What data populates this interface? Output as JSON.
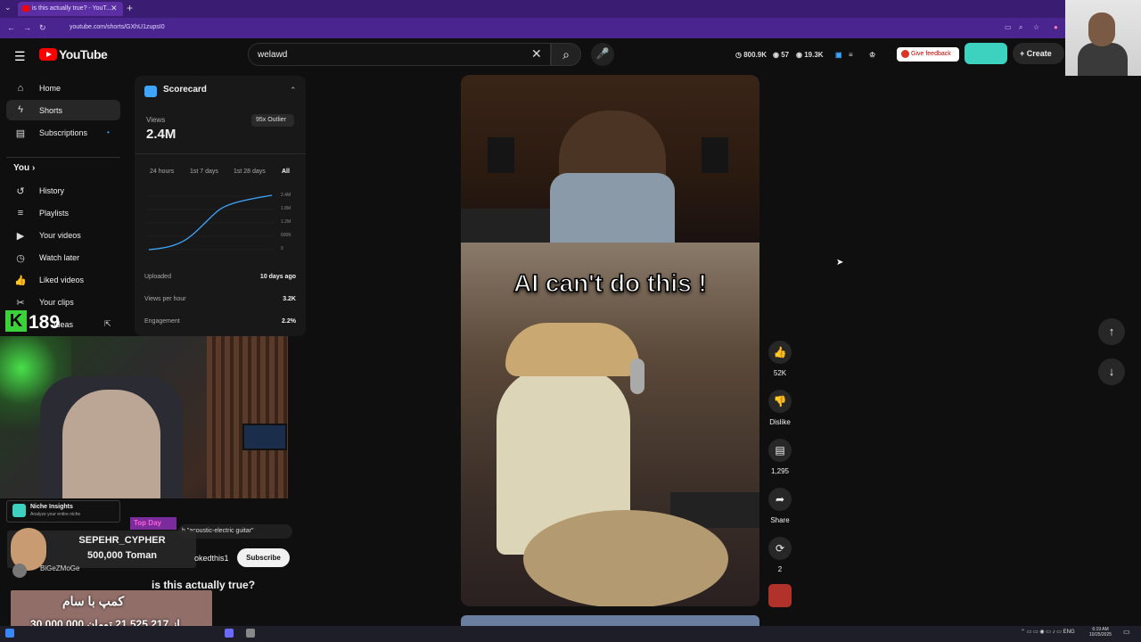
{
  "browser": {
    "tab_title": "is this actually true? - YouT...",
    "url": "youtube.com/shorts/GXhU1zupsI0",
    "new_tab": "+",
    "close": "✕"
  },
  "youtube": {
    "brand": "YouTube",
    "search_value": "welawd",
    "stats": {
      "subs": "800.9K",
      "videos": "57",
      "views": "19.3K"
    },
    "feedback_label": "Give feedback",
    "create_label": "Create"
  },
  "sidebar": {
    "items": [
      {
        "label": "Home",
        "icon": "home-icon"
      },
      {
        "label": "Shorts",
        "icon": "shorts-icon"
      },
      {
        "label": "Subscriptions",
        "icon": "subscriptions-icon"
      }
    ],
    "you_header": "You",
    "you_items": [
      {
        "label": "History",
        "icon": "history-icon"
      },
      {
        "label": "Playlists",
        "icon": "playlists-icon"
      },
      {
        "label": "Your videos",
        "icon": "your-videos-icon"
      },
      {
        "label": "Watch later",
        "icon": "watch-later-icon"
      },
      {
        "label": "Liked videos",
        "icon": "liked-videos-icon"
      },
      {
        "label": "Your clips",
        "icon": "clips-icon"
      },
      {
        "label": "Ideas",
        "icon": "ideas-icon"
      }
    ]
  },
  "scorecard": {
    "title": "Scorecard",
    "views_label": "Views",
    "views_value": "2.4M",
    "outlier": "95x Outlier",
    "ranges": [
      "24 hours",
      "1st 7 days",
      "1st 28 days",
      "All"
    ],
    "y_ticks": [
      "2.4M",
      "1.8M",
      "1.2M",
      "600K",
      "0"
    ],
    "rows": [
      {
        "label": "Uploaded",
        "value": "10 days ago"
      },
      {
        "label": "Views per hour",
        "value": "3.2K"
      },
      {
        "label": "Engagement",
        "value": "2.2%"
      }
    ]
  },
  "overlay": {
    "k_badge": "K",
    "k_count": "189",
    "niche_title": "Niche Insights",
    "niche_sub": "Analyze your entire niche",
    "top_day": "Top Day",
    "search_pill": "h \"acoustic-electric guitar\"",
    "donor_name": "SEPEHR_CYPHER",
    "donor_amount": "500,000 Toman",
    "channel_left": "BiGeZMoGe",
    "goal_title": "کمپ با سام",
    "goal_progress": "30,000,000 از 21,525,217 تومان"
  },
  "short": {
    "channel": "okedthis1",
    "subscribe_label": "Subscribe",
    "title": "is this actually true?",
    "caption": "AI can't do this !",
    "likes": "52K",
    "dislike_label": "Dislike",
    "comments": "1,295",
    "share_label": "Share",
    "remix": "2"
  },
  "taskbar": {
    "lang": "ENG",
    "time": "6:19 AM",
    "date": "10/25/2025"
  }
}
